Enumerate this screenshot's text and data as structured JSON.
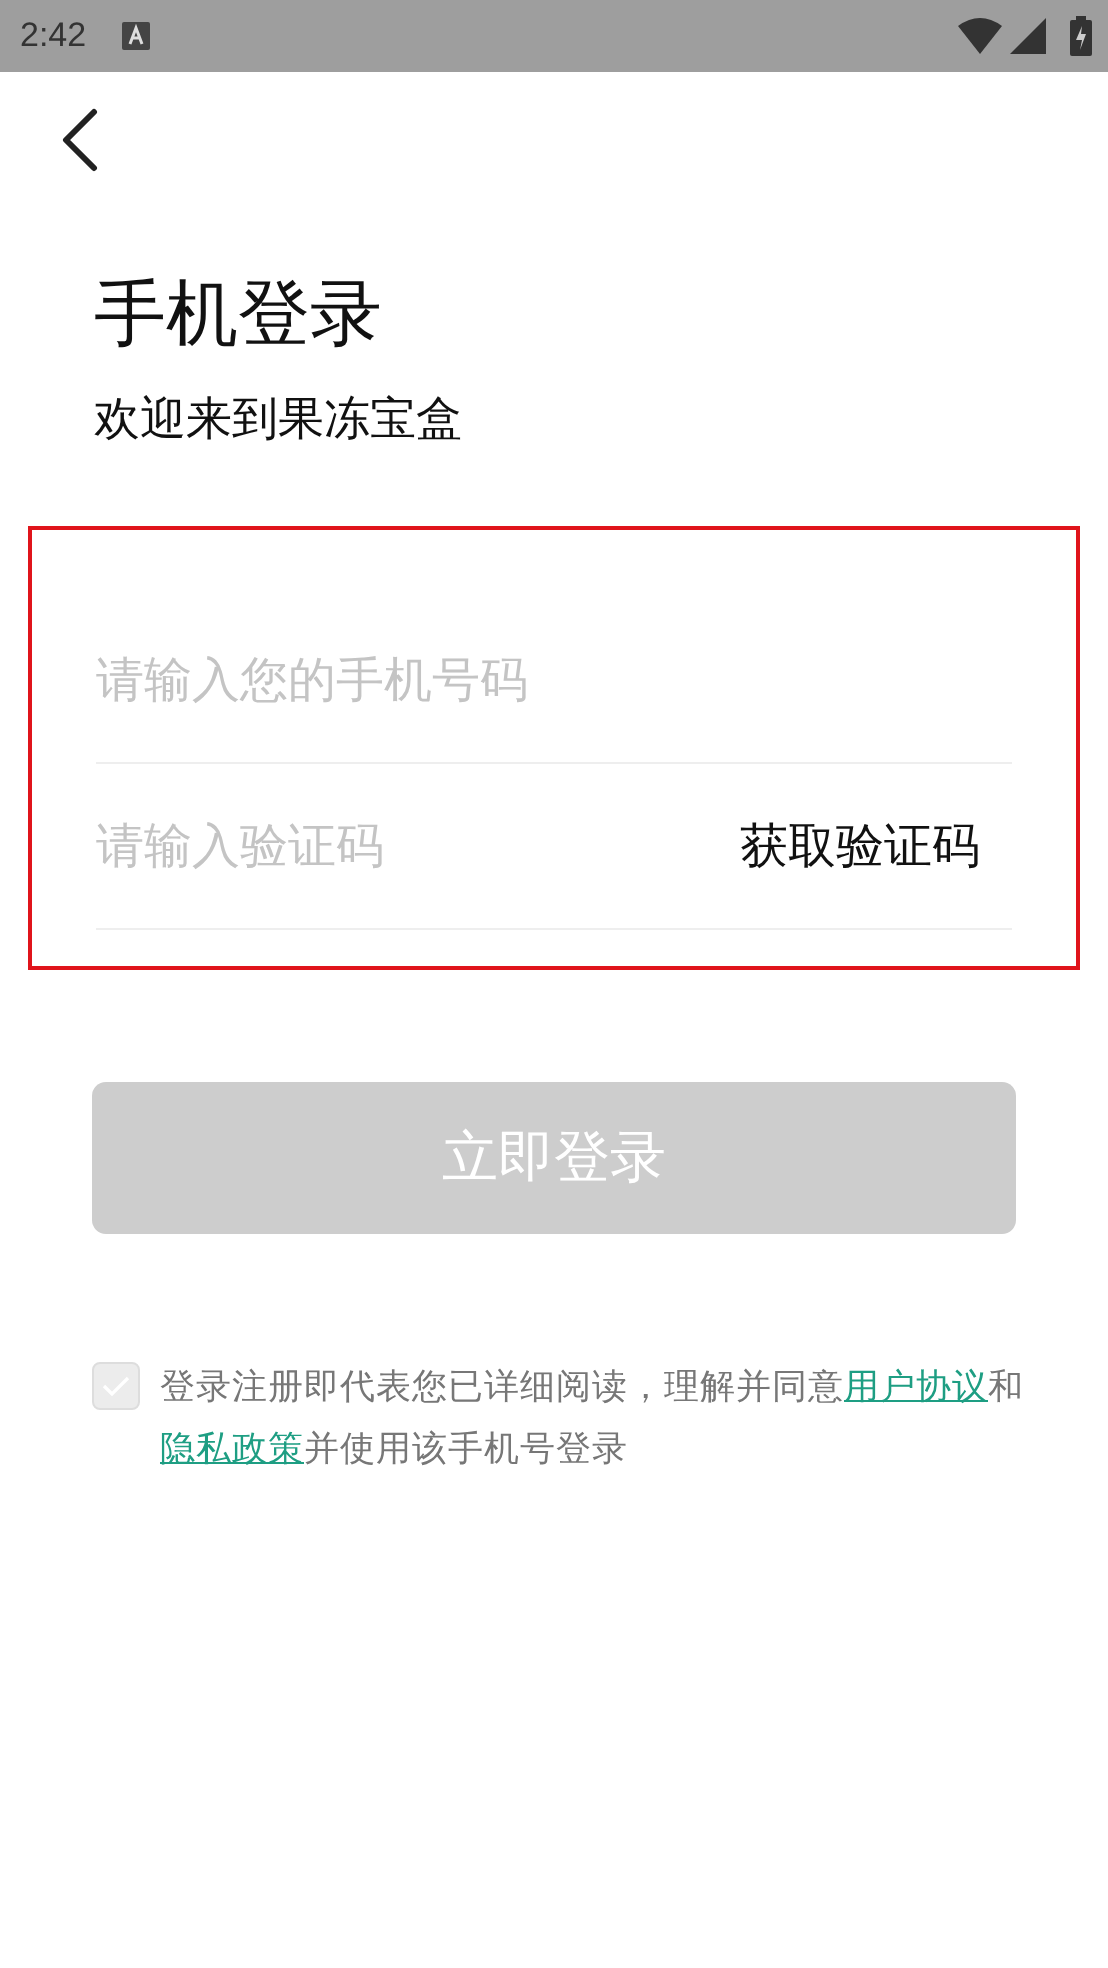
{
  "status_bar": {
    "time": "2:42"
  },
  "title": "手机登录",
  "subtitle": "欢迎来到果冻宝盒",
  "form": {
    "highlighted": true,
    "phone": {
      "placeholder": "请输入您的手机号码"
    },
    "code": {
      "placeholder": "请输入验证码"
    },
    "get_code_button": "获取验证码"
  },
  "login_button": {
    "label": "立即登录",
    "disabled": true
  },
  "agreement": {
    "checked": false,
    "parts": [
      {
        "kind": "text",
        "text": "登录注册即代表您已详细阅读，理解并同意"
      },
      {
        "kind": "link",
        "text": "用户协议"
      },
      {
        "kind": "text",
        "text": "和"
      },
      {
        "kind": "link",
        "text": "隐私政策"
      },
      {
        "kind": "text",
        "text": "并使用该手机号登录"
      }
    ]
  }
}
